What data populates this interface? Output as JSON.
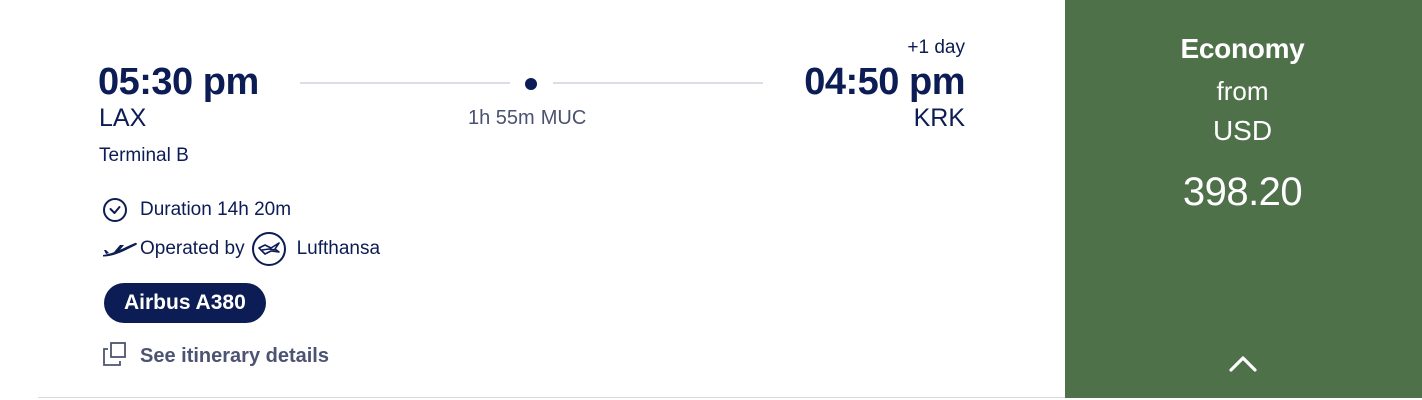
{
  "flight": {
    "departure": {
      "time": "05:30 pm",
      "airport": "LAX",
      "terminal": "Terminal B"
    },
    "arrival": {
      "time": "04:50 pm",
      "airport": "KRK",
      "day_offset": "+1 day"
    },
    "stop": {
      "layover": "1h 55m",
      "airport": "MUC"
    },
    "duration": "Duration 14h 20m",
    "operated_by_label": "Operated by",
    "airline": "Lufthansa",
    "aircraft": "Airbus A380",
    "itinerary_link": "See itinerary details"
  },
  "fare": {
    "class": "Economy",
    "from_label": "from",
    "currency": "USD",
    "price": "398.20"
  },
  "icons": {
    "duration": "clock-icon",
    "operator": "airplane-icon",
    "airline_logo": "lufthansa-crane-logo",
    "itinerary": "external-window-icon",
    "toggle": "chevron-up-icon"
  },
  "colors": {
    "primary": "#0c1c54",
    "muted": "#4d5471",
    "fare_panel": "#4e714a"
  }
}
